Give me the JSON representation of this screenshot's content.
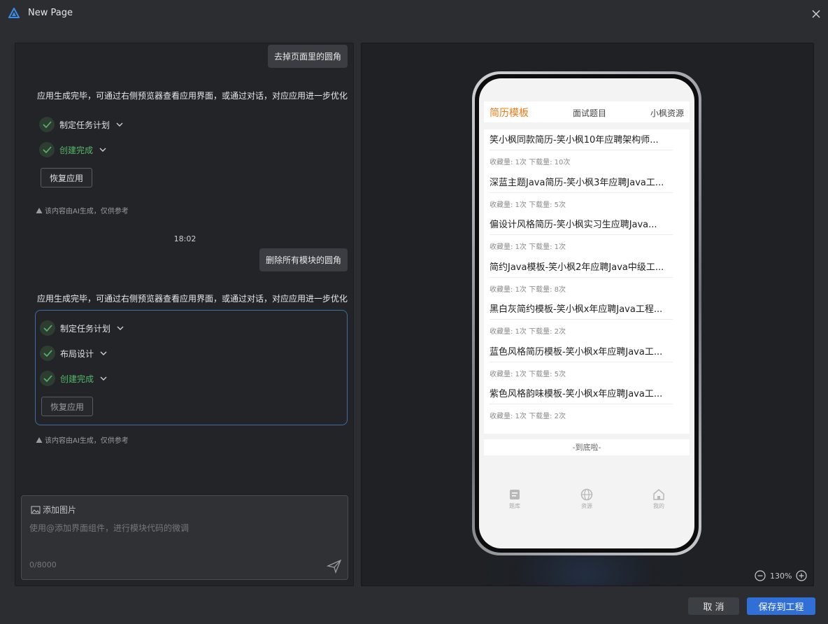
{
  "window": {
    "title": "New Page"
  },
  "chat": {
    "msg1_user": "去掉页面里的圆角",
    "msg1_ai": "应用生成完毕，可通过右侧预览器查看应用界面，或通过对话，对应应用进一步优化",
    "msg1_steps": [
      "制定任务计划",
      "创建完成"
    ],
    "restore_label": "恢复应用",
    "ai_note": "该内容由AI生成，仅供参考",
    "timestamp": "18:02",
    "msg2_user": "删除所有模块的圆角",
    "msg2_ai": "应用生成完毕，可通过右侧预览器查看应用界面，或通过对话，对应应用进一步优化",
    "msg2_steps": [
      "制定任务计划",
      "布局设计",
      "创建完成"
    ]
  },
  "composer": {
    "add_image": "添加图片",
    "placeholder": "使用@添加界面组件，进行模块代码的微调",
    "counter": "0/8000"
  },
  "preview": {
    "tabs": [
      "简历模板",
      "面试题目",
      "小枫资源"
    ],
    "items": [
      {
        "title": "笑小枫同款简历-笑小枫10年应聘架构师...",
        "meta": "收藏量: 1次 下载量: 10次"
      },
      {
        "title": "深蓝主题Java简历-笑小枫3年应聘Java工...",
        "meta": "收藏量: 1次 下载量: 5次"
      },
      {
        "title": "偏设计风格简历-笑小枫实习生应聘Java...",
        "meta": "收藏量: 1次 下载量: 1次"
      },
      {
        "title": "简约Java模板-笑小枫2年应聘Java中级工...",
        "meta": "收藏量: 1次 下载量: 8次"
      },
      {
        "title": "黑白灰简约模板-笑小枫x年应聘Java工程...",
        "meta": "收藏量: 1次 下载量: 2次"
      },
      {
        "title": "蓝色风格简历模板-笑小枫x年应聘Java工...",
        "meta": "收藏量: 1次 下载量: 5次"
      },
      {
        "title": "紫色风格韵味模板-笑小枫x年应聘Java工...",
        "meta": "收藏量: 1次 下载量: 2次"
      }
    ],
    "bottom_note": "-到底啦-",
    "nav": [
      "题库",
      "资源",
      "我的"
    ],
    "zoom": "130%"
  },
  "footer": {
    "cancel": "取 消",
    "save": "保存到工程"
  },
  "colors": {
    "accent": "#f07a12",
    "primary": "#2f6fd6",
    "success": "#55b866"
  }
}
